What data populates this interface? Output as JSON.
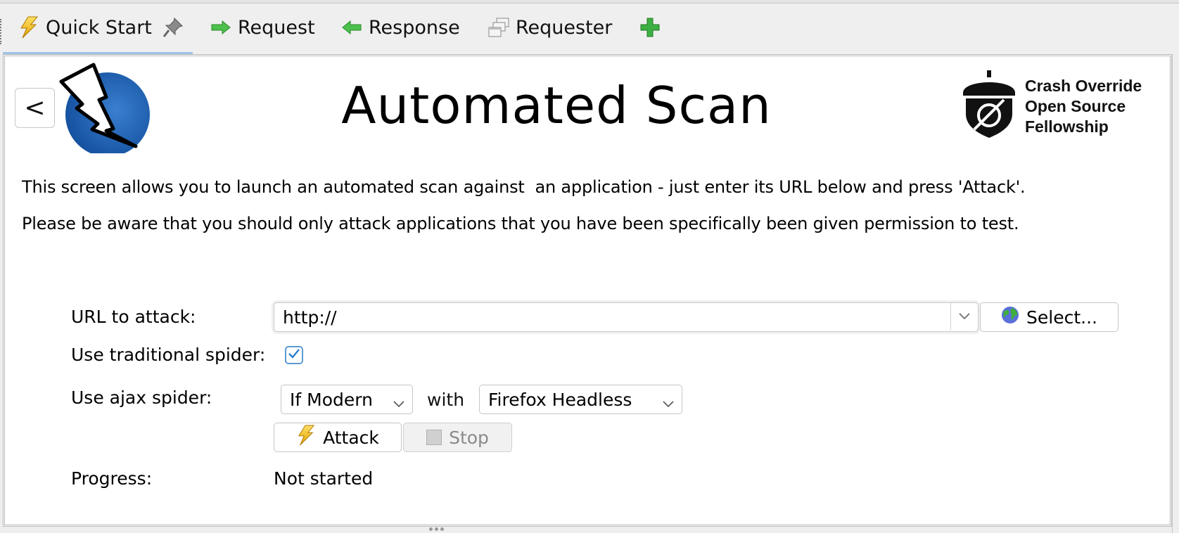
{
  "tabs": [
    {
      "label": "Quick Start",
      "icon": "lightning-icon",
      "pinned": true,
      "active": true
    },
    {
      "label": "Request",
      "icon": "arrow-right-icon"
    },
    {
      "label": "Response",
      "icon": "arrow-left-icon"
    },
    {
      "label": "Requester",
      "icon": "windows-icon"
    }
  ],
  "add_tab_icon": "plus-icon",
  "header": {
    "back_label": "<",
    "title": "Automated Scan",
    "sponsor_lines": [
      "Crash Override",
      "Open Source",
      "Fellowship"
    ]
  },
  "description": {
    "line1": "This screen allows you to launch an automated scan against  an application - just enter its URL below and press 'Attack'.",
    "line2": "Please be aware that you should only attack applications that you have been specifically been given permission to test."
  },
  "form": {
    "url_label": "URL to attack:",
    "url_value": "http://",
    "select_label": "Select...",
    "traditional_spider_label": "Use traditional spider:",
    "traditional_spider_checked": true,
    "ajax_spider_label": "Use ajax spider:",
    "ajax_mode_selected": "If Modern",
    "with_label": "with",
    "browser_selected": "Firefox Headless",
    "attack_label": "Attack",
    "stop_label": "Stop",
    "stop_enabled": false,
    "progress_label": "Progress:",
    "progress_value": "Not started"
  },
  "colors": {
    "accent_tab_underline": "#9ec2e6",
    "checkbox_accent": "#5b9bd5",
    "zap_blue": "#1f5faa",
    "lightning_yellow": "#f2c21b",
    "arrow_green": "#3cb043"
  }
}
